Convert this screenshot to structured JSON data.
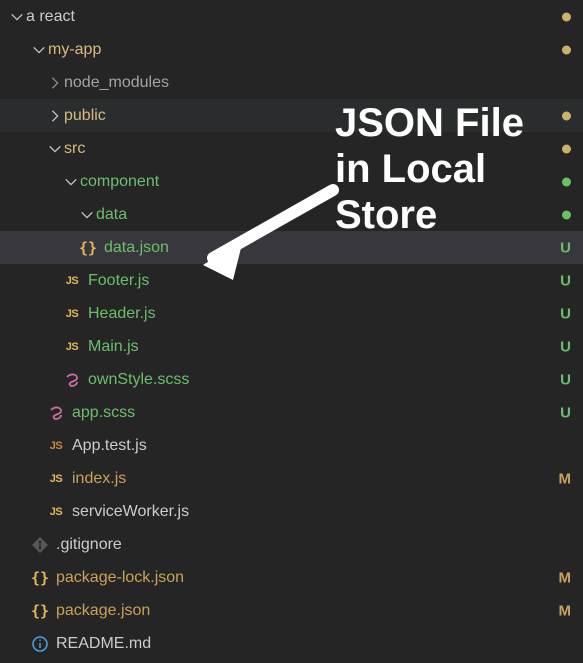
{
  "annotation": {
    "line1": "JSON File",
    "line2": "in Local",
    "line3": "Store"
  },
  "tree": {
    "root": {
      "label": "a react",
      "dot": "yellow"
    },
    "myapp": {
      "label": "my-app",
      "dot": "yellow"
    },
    "node_modules": {
      "label": "node_modules"
    },
    "public": {
      "label": "public",
      "dot": "yellow"
    },
    "src": {
      "label": "src",
      "dot": "yellow"
    },
    "component": {
      "label": "component",
      "dot": "green"
    },
    "data_folder": {
      "label": "data",
      "dot": "green"
    },
    "data_json": {
      "label": "data.json",
      "status": "U"
    },
    "footer": {
      "label": "Footer.js",
      "status": "U"
    },
    "header": {
      "label": "Header.js",
      "status": "U"
    },
    "main": {
      "label": "Main.js",
      "status": "U"
    },
    "ownstyle": {
      "label": "ownStyle.scss",
      "status": "U"
    },
    "appscss": {
      "label": "app.scss",
      "status": "U"
    },
    "apptest": {
      "label": "App.test.js"
    },
    "index": {
      "label": "index.js",
      "status": "M"
    },
    "sw": {
      "label": "serviceWorker.js"
    },
    "gitignore": {
      "label": ".gitignore"
    },
    "pkglock": {
      "label": "package-lock.json",
      "status": "M"
    },
    "pkg": {
      "label": "package.json",
      "status": "M"
    },
    "readme": {
      "label": "README.md"
    }
  }
}
